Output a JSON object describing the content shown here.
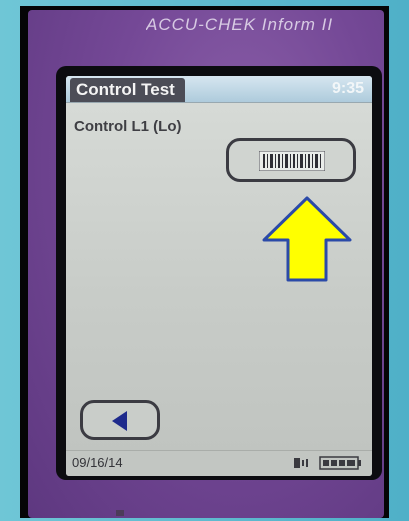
{
  "device": {
    "brand": "ACCU-CHEK Inform II"
  },
  "screen": {
    "title": "Control Test",
    "time": "9:35",
    "subtitle": "Control L1 (Lo)",
    "date": "09/16/14"
  },
  "icons": {
    "barcode": "barcode-icon",
    "back": "left-triangle-icon",
    "bluetooth": "connectivity-icon",
    "battery": "battery-icon",
    "annotation": "up-arrow-icon"
  },
  "colors": {
    "arrow_fill": "#ffff00",
    "arrow_outline": "#2b4aa8",
    "title_tab": "#4c4d57",
    "device_body": "#744896"
  }
}
